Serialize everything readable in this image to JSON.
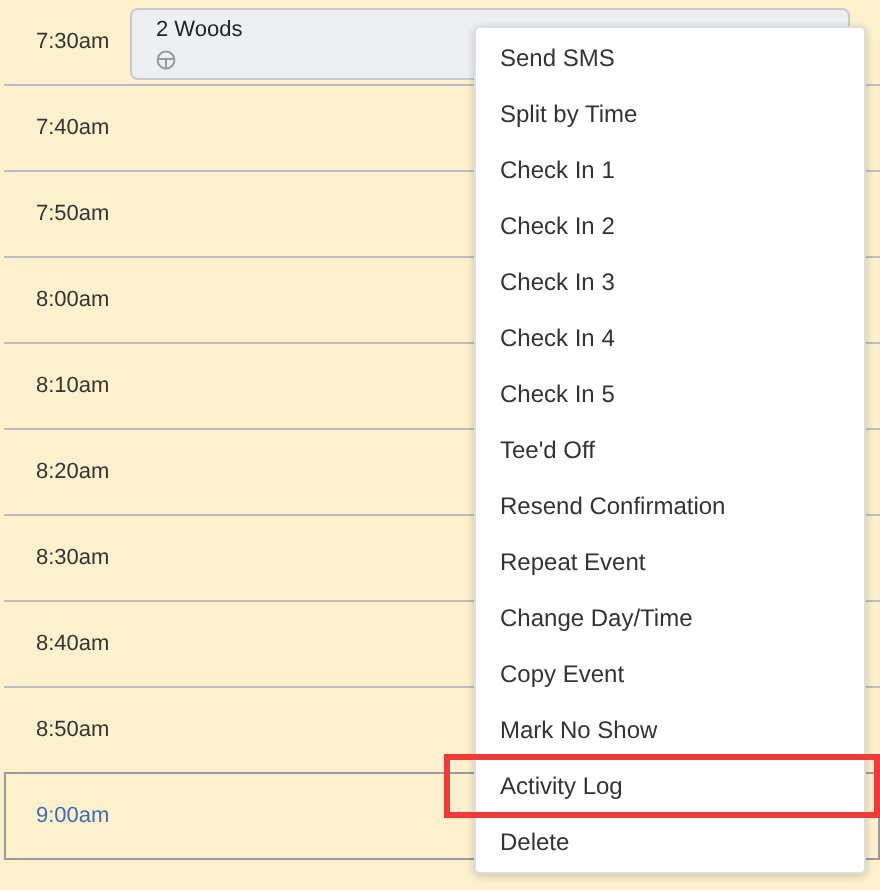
{
  "slots": [
    {
      "time": "7:30am",
      "selected": false
    },
    {
      "time": "7:40am",
      "selected": false
    },
    {
      "time": "7:50am",
      "selected": false
    },
    {
      "time": "8:00am",
      "selected": false
    },
    {
      "time": "8:10am",
      "selected": false
    },
    {
      "time": "8:20am",
      "selected": false
    },
    {
      "time": "8:30am",
      "selected": false
    },
    {
      "time": "8:40am",
      "selected": false
    },
    {
      "time": "8:50am",
      "selected": false
    },
    {
      "time": "9:00am",
      "selected": true
    }
  ],
  "event": {
    "title": "2 Woods"
  },
  "context_menu": [
    {
      "label": "Send SMS",
      "highlighted": false
    },
    {
      "label": "Split by Time",
      "highlighted": false
    },
    {
      "label": "Check In 1",
      "highlighted": false
    },
    {
      "label": "Check In 2",
      "highlighted": false
    },
    {
      "label": "Check In 3",
      "highlighted": false
    },
    {
      "label": "Check In 4",
      "highlighted": false
    },
    {
      "label": "Check In 5",
      "highlighted": false
    },
    {
      "label": "Tee'd Off",
      "highlighted": false
    },
    {
      "label": "Resend Confirmation",
      "highlighted": false
    },
    {
      "label": "Repeat Event",
      "highlighted": false
    },
    {
      "label": "Change Day/Time",
      "highlighted": false
    },
    {
      "label": "Copy Event",
      "highlighted": false
    },
    {
      "label": "Mark No Show",
      "highlighted": false
    },
    {
      "label": "Activity Log",
      "highlighted": true
    },
    {
      "label": "Delete",
      "highlighted": false
    }
  ]
}
